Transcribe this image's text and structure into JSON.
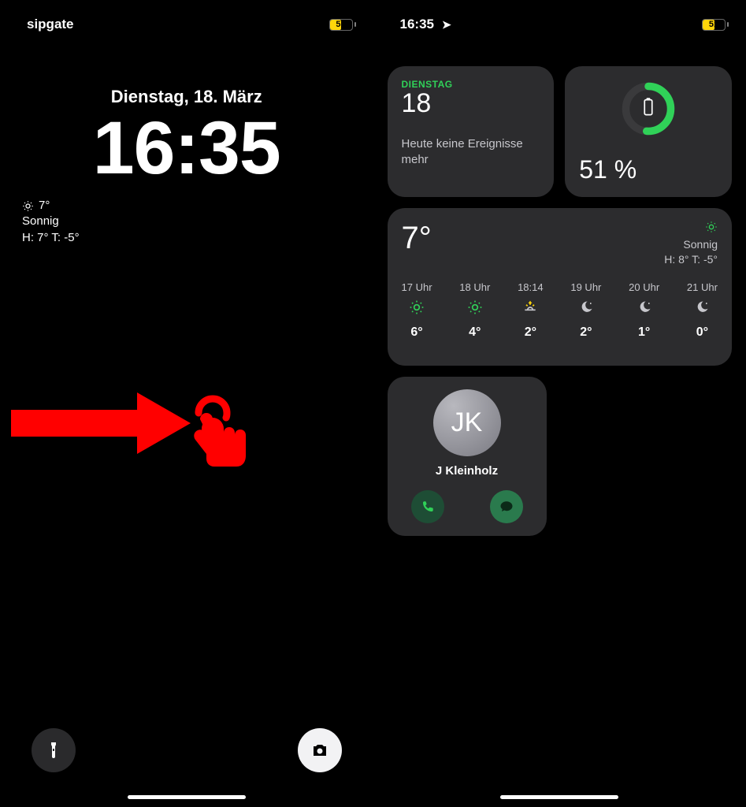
{
  "left": {
    "status": {
      "carrier": "sipgate",
      "battery": "51"
    },
    "date": "Dienstag, 18. März",
    "time": "16:35",
    "weather": {
      "temp": "7°",
      "cond": "Sonnig",
      "hilo": "H: 7° T: -5°"
    }
  },
  "right": {
    "status": {
      "time": "16:35",
      "battery": "51"
    },
    "calendar": {
      "dow": "DIENSTAG",
      "day": "18",
      "events": "Heute keine Ereignisse mehr"
    },
    "batteryWidget": {
      "percent": "51 %",
      "percent_num": 51
    },
    "weather": {
      "temp": "7°",
      "cond": "Sonnig",
      "hilo": "H: 8° T: -5°",
      "hours": [
        {
          "t": "17 Uhr",
          "icon": "sun",
          "v": "6°"
        },
        {
          "t": "18 Uhr",
          "icon": "sun",
          "v": "4°"
        },
        {
          "t": "18:14",
          "icon": "sunset",
          "v": "2°"
        },
        {
          "t": "19 Uhr",
          "icon": "moon",
          "v": "2°"
        },
        {
          "t": "20 Uhr",
          "icon": "moon",
          "v": "1°"
        },
        {
          "t": "21 Uhr",
          "icon": "moon",
          "v": "0°"
        }
      ]
    },
    "contact": {
      "initials": "JK",
      "name": "J Kleinholz"
    }
  },
  "colors": {
    "green": "#30d158",
    "yellow": "#ffd60a",
    "red": "#ff0000"
  }
}
